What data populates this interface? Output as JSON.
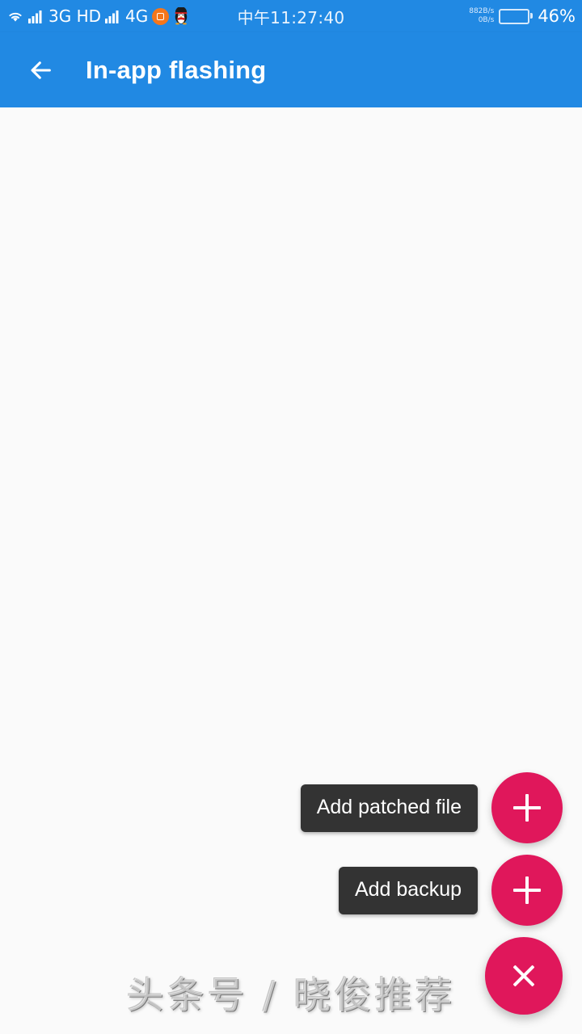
{
  "status_bar": {
    "wifi_icon": "wifi-icon",
    "signal_icon_1": "signal-bars-icon",
    "network_label_1": "3G HD",
    "signal_icon_2": "signal-bars-icon",
    "network_label_2": "4G",
    "screenshot_icon": "screen-recorder-icon",
    "qq_icon": "qq-penguin-icon",
    "time": "中午11:27:40",
    "net_speed_down": "882B/s",
    "net_speed_up": "0B/s",
    "battery_icon": "battery-icon",
    "battery_percent": "46%",
    "battery_level": 46
  },
  "app_bar": {
    "back_icon": "arrow-back-icon",
    "title": "In-app flashing",
    "background_color": "#2189E3"
  },
  "content": {
    "background_color": "#fafafa",
    "items": []
  },
  "speed_dial": {
    "expanded": true,
    "accent_color": "#E0175B",
    "actions": [
      {
        "label": "Add patched file",
        "icon": "plus-icon"
      },
      {
        "label": "Add backup",
        "icon": "plus-icon"
      }
    ],
    "main_icon": "close-icon"
  },
  "watermark": {
    "text": "头条号 / 晓俊推荐"
  }
}
